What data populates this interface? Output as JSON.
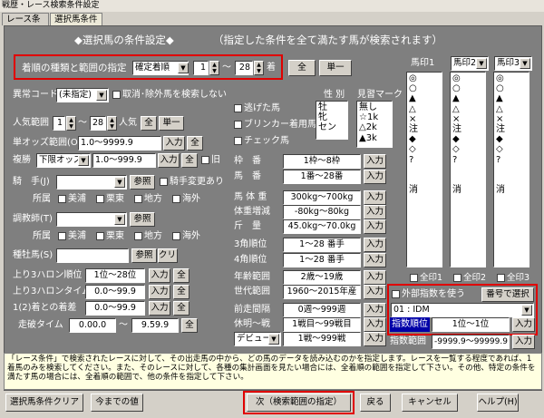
{
  "window": {
    "title": "戦歴・レース検索条件設定"
  },
  "tabs": [
    "レース条件",
    "選択馬条件"
  ],
  "header": {
    "title": "◆選択馬の条件設定◆",
    "subtitle": "（指定した条件を全て満たす馬が検索されます）"
  },
  "finish": {
    "label": "着順の種類と範囲の指定",
    "type": "確定着順",
    "from": "1",
    "sep": "〜",
    "to": "28",
    "suffix": "着",
    "all_btn": "全",
    "single_btn": "単一"
  },
  "abnormal": {
    "label": "異常コード",
    "value": "(未指定)",
    "check_label": "取消･除外馬を検索しない"
  },
  "popularity": {
    "label": "人気範囲",
    "from": "1",
    "sep": "〜",
    "to": "28",
    "suffix": "人気",
    "all_btn": "全",
    "single_btn": "単一"
  },
  "win_odds": {
    "label": "単オッズ範囲(O)",
    "value": "1.0〜9999.9",
    "input_btn": "入力",
    "all_btn": "全"
  },
  "place_odds": {
    "label": "複勝",
    "type": "下限オッズ",
    "value": "1.0〜999.9",
    "input_btn": "入力",
    "all_btn": "全",
    "check_label": "旧"
  },
  "jockey": {
    "label": "騎　手(J)",
    "ref_btn": "参照",
    "check_label": "騎手変更あり",
    "affil_label": "所属",
    "affil": [
      "美浦",
      "栗東",
      "地方",
      "海外"
    ]
  },
  "trainer": {
    "label": "調教師(T)",
    "ref_btn": "参照",
    "affil_label": "所属",
    "affil": [
      "美浦",
      "栗東",
      "地方",
      "海外"
    ]
  },
  "sire": {
    "label": "種牡馬(S)",
    "ref_btn": "参照",
    "clear_btn": "クリア"
  },
  "last3f_rank": {
    "label": "上り3ハロン順位",
    "value": "1位〜28位",
    "input_btn": "入力",
    "all_btn": "全"
  },
  "last3f_time": {
    "label": "上り3ハロンタイム",
    "value": "0.0〜99.9",
    "input_btn": "入力",
    "all_btn": "全"
  },
  "margin_1st": {
    "label": "1(2)着との着差",
    "value": "0.0〜99.9",
    "input_btn": "入力",
    "all_btn": "全"
  },
  "run_time": {
    "label": "走破タイム",
    "from": "0.00.0",
    "sep": "〜",
    "to": "9.59.9",
    "all_btn": "全"
  },
  "checks": [
    "逃げた馬",
    "ブリンカー着用馬",
    "チェック馬"
  ],
  "sex": {
    "label": "性 別",
    "items": [
      "牡",
      "牝",
      "セン"
    ]
  },
  "marks": {
    "label": "見習マーク",
    "items": [
      "無し",
      "☆1k",
      "△2k",
      "▲3k"
    ]
  },
  "ranges": [
    {
      "label": "枠　番",
      "value": "1枠〜8枠",
      "btn": "入力"
    },
    {
      "label": "馬　番",
      "value": "1番〜28番",
      "btn": "入力"
    },
    {
      "label": "馬 体 重",
      "value": "300kg〜700kg",
      "btn": "入力"
    },
    {
      "label": "体重増減",
      "value": "-80kg〜80kg",
      "btn": "入力"
    },
    {
      "label": "斤　量",
      "value": "45.0kg〜70.0kg",
      "btn": "入力"
    },
    {
      "label": "3角順位",
      "value": "1〜28 番手",
      "btn": "入力"
    },
    {
      "label": "4角順位",
      "value": "1〜28 番手",
      "btn": "入力"
    },
    {
      "label": "年齢範囲",
      "value": "2歳〜19歳",
      "btn": "入力"
    },
    {
      "label": "世代範囲",
      "value": "1960〜2015年産",
      "btn": "入力"
    },
    {
      "label": "前走間隔",
      "value": "0週〜999週",
      "btn": "入力"
    },
    {
      "label": "休明〜戦",
      "value": "1戦目〜99戦目",
      "btn": "入力"
    }
  ],
  "debut": {
    "type": "デビュー",
    "value": "1戦〜999戦",
    "btn": "入力"
  },
  "mark_lists": [
    {
      "label": "馬印1",
      "items": [
        "◎",
        "○",
        "▲",
        "△",
        "×",
        "注",
        "◆",
        "◇",
        "?",
        "",
        "",
        "消"
      ],
      "all_label": "全印1"
    },
    {
      "label": "馬印2",
      "items": [
        "◎",
        "○",
        "▲",
        "△",
        "×",
        "注",
        "◆",
        "◇",
        "?",
        "",
        "",
        "消"
      ],
      "all_label": "全印2"
    },
    {
      "label": "馬印3",
      "items": [
        "◎",
        "○",
        "▲",
        "△",
        "×",
        "注",
        "◆",
        "◇",
        "?",
        "",
        "",
        "消"
      ],
      "all_label": "全印3"
    }
  ],
  "external": {
    "check_label": "外部指数を使う",
    "select_btn": "番号で選択",
    "index": "01 : IDM",
    "rank_label": "指数順位",
    "rank_value": "1位〜1位",
    "rank_btn": "入力",
    "range_label": "指数範囲",
    "range_value": "-9999.9〜99999.9",
    "range_btn": "入力"
  },
  "note": "「レース条件」で検索されたレースに対して、その出走馬の中から、どの馬のデータを読み込むのかを指定します。レースを一覧する程度であれば、1着馬のみを検索してください。また、そのレースに対して、各種の集計画面を見たい場合には、全着順の範囲を指定して下さい。その他、特定の条件を満たす馬の場合には、全着順の範囲で、他の条件を指定して下さい。",
  "footer": {
    "clear_btn": "選択馬条件クリア",
    "prev_btn": "今までの値",
    "next_btn": "次（検索範囲の指定）",
    "back_btn": "戻る",
    "cancel_btn": "キャンセル",
    "help_btn": "ヘルプ(H)"
  }
}
